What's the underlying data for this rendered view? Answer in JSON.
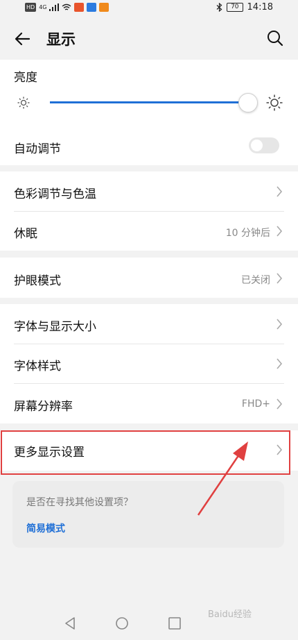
{
  "status_bar": {
    "left_chips": [
      "HD",
      "4G"
    ],
    "battery": "70",
    "time": "14:18"
  },
  "header": {
    "title": "显示"
  },
  "brightness": {
    "label": "亮度",
    "level_percent": 100
  },
  "auto_adjust": {
    "label": "自动调节",
    "on": false
  },
  "rows": {
    "color": {
      "label": "色彩调节与色温"
    },
    "sleep": {
      "label": "休眠",
      "value": "10 分钟后"
    },
    "eye": {
      "label": "护眼模式",
      "value": "已关闭"
    },
    "font_size": {
      "label": "字体与显示大小"
    },
    "font_style": {
      "label": "字体样式"
    },
    "resolution": {
      "label": "屏幕分辨率",
      "value": "FHD+"
    },
    "more": {
      "label": "更多显示设置"
    }
  },
  "suggestion": {
    "question": "是否在寻找其他设置项？",
    "link": "简易模式"
  },
  "watermark": "Baidu经验",
  "colors": {
    "accent": "#1f6fd6",
    "highlight": "#e04040"
  }
}
